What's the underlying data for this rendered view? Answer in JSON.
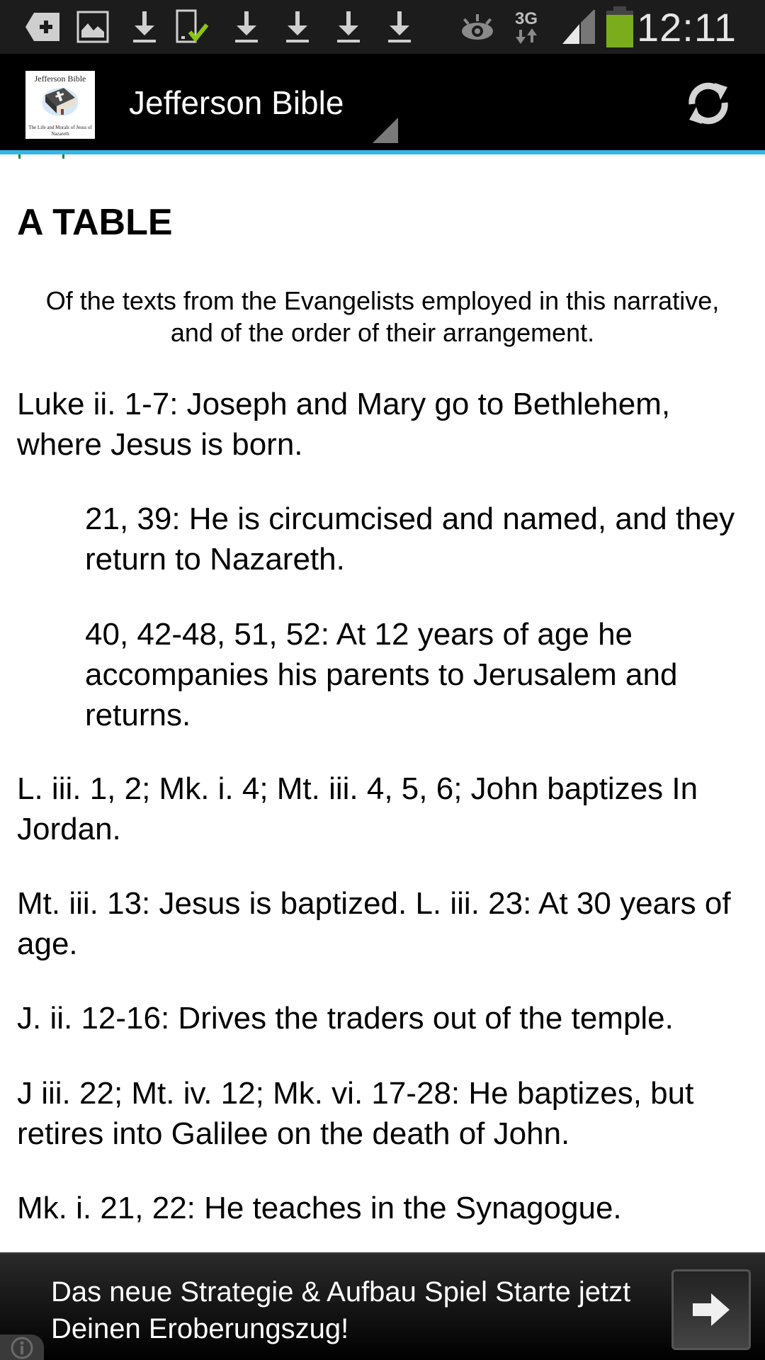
{
  "status_bar": {
    "time": "12:11",
    "network": "3G",
    "battery_level": 1.0,
    "icons": [
      "add-notification-icon",
      "image-icon",
      "download-icon",
      "device-check-icon",
      "download-icon",
      "download-icon",
      "download-icon",
      "download-icon",
      "eye-icon",
      "network-3g-icon",
      "signal-icon",
      "battery-icon"
    ]
  },
  "action_bar": {
    "title": "Jefferson Bible",
    "app_icon_title": "Jefferson Bible",
    "app_icon_subtitle": "The Life and Morals of Jesus of Nazareth",
    "refresh_icon": "refresh-icon"
  },
  "colors": {
    "accent": "#33b5e5",
    "status_bar_bg": "#1c1c1c",
    "action_bar_bg": "#000000",
    "battery_green": "#7aac1c"
  },
  "content": {
    "heading": "A TABLE",
    "subtitle": "Of the texts from the Evangelists employed in this narrative, and of the order of their arrangement.",
    "entries": [
      {
        "level": 0,
        "text": "Luke ii. 1-7: Joseph and Mary go to Bethlehem, where Jesus is born."
      },
      {
        "level": 1,
        "text": "21, 39: He is circumcised and named, and they return to Nazareth."
      },
      {
        "level": 1,
        "text": "40, 42-48, 51, 52: At 12 years of age he accompanies his parents to Jerusalem and returns."
      },
      {
        "level": 0,
        "text": "L. iii. 1, 2; Mk. i. 4; Mt. iii. 4, 5, 6; John baptizes In Jordan."
      },
      {
        "level": 0,
        "text": "Mt. iii. 13: Jesus is baptized. L. iii. 23: At 30 years of age."
      },
      {
        "level": 0,
        "text": "J. ii. 12-16: Drives the traders out of the temple."
      },
      {
        "level": 0,
        "text": "J iii. 22; Mt. iv. 12; Mk. vi. 17-28: He baptizes, but retires into Galilee on the death of John."
      },
      {
        "level": 0,
        "text": "Mk. i. 21, 22: He teaches in the Synagogue."
      }
    ]
  },
  "ad": {
    "text": "Das neue Strategie & Aufbau Spiel Starte jetzt Deinen Eroberungszug!",
    "arrow_icon": "arrow-right-icon",
    "info_icon": "info-icon"
  }
}
